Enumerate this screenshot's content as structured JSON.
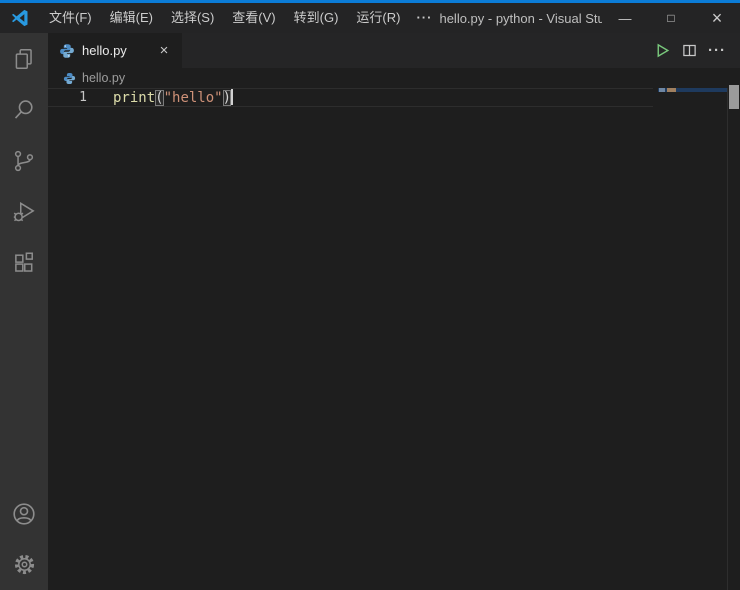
{
  "window": {
    "title": "hello.py - python - Visual Stu...",
    "accent_color": "#0b7cd7"
  },
  "menu_bar": {
    "items": [
      "文件(F)",
      "编辑(E)",
      "选择(S)",
      "查看(V)",
      "转到(G)",
      "运行(R)"
    ],
    "overflow": "···"
  },
  "window_controls": {
    "minimize": "—",
    "maximize": "□",
    "close": "×"
  },
  "activity_bar": {
    "items": [
      {
        "name": "explorer",
        "icon": "files-icon"
      },
      {
        "name": "search",
        "icon": "search-icon"
      },
      {
        "name": "source-control",
        "icon": "source-control-icon"
      },
      {
        "name": "run-and-debug",
        "icon": "debug-icon"
      },
      {
        "name": "extensions",
        "icon": "extensions-icon"
      }
    ],
    "bottom_items": [
      {
        "name": "accounts",
        "icon": "account-icon"
      },
      {
        "name": "settings",
        "icon": "gear-icon"
      }
    ]
  },
  "tab_bar": {
    "tabs": [
      {
        "label": "hello.py",
        "icon": "python-icon",
        "close": "×",
        "active": true
      }
    ],
    "actions": {
      "run": "run-python-file-icon",
      "split": "split-editor-icon",
      "more": "···"
    }
  },
  "breadcrumb": {
    "file": "hello.py"
  },
  "editor": {
    "lines": [
      {
        "number": "1",
        "tokens": {
          "function": "print",
          "open_paren": "(",
          "string": "\"hello\"",
          "close_paren": ")"
        }
      }
    ]
  },
  "colors": {
    "accent": "#0b7cd7",
    "titlebar_bg": "#242425",
    "tabstrip_bg": "#252526",
    "editor_bg": "#1e1e1e",
    "activitybar_bg": "#333333",
    "icon_gray": "#8c8c8c",
    "function_token": "#dcdcaa",
    "string_token": "#ce9178",
    "run_green": "#89d185",
    "python_blue": "#4d8cc4"
  }
}
